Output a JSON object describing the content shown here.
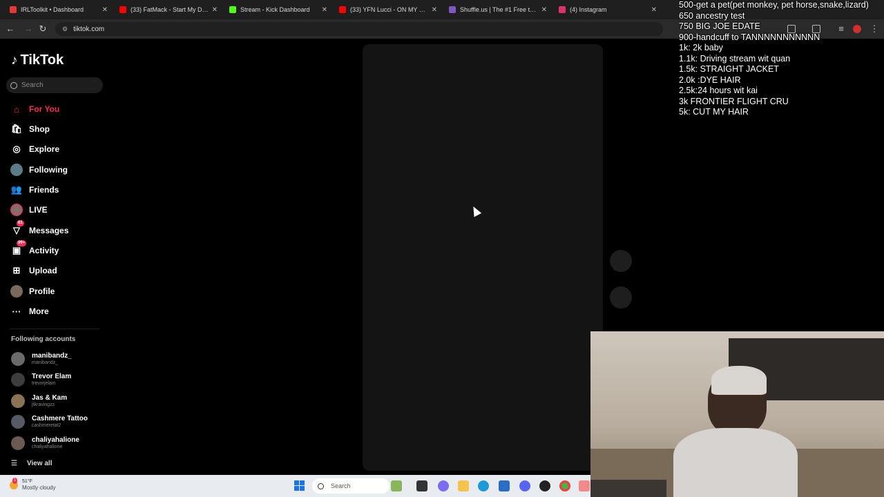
{
  "browser": {
    "tabs": [
      {
        "title": "IRLToolkit • Dashboard",
        "color": "#e53935"
      },
      {
        "title": "(33) FatMack - Start My Day [O",
        "color": "#ff0000"
      },
      {
        "title": "Stream - Kick Dashboard",
        "color": "#53fc18"
      },
      {
        "title": "(33) YFN Lucci - ON MY MIND",
        "color": "#ff0000"
      },
      {
        "title": "Shuffle.us | The #1 Free to Play",
        "color": "#7e57c2"
      },
      {
        "title": "(4) Instagram",
        "color": "#e1306c"
      }
    ],
    "address": "tiktok.com"
  },
  "tiktok": {
    "logo": "TikTok",
    "search_placeholder": "Search",
    "nav": [
      {
        "label": "For You",
        "icon": "home-icon"
      },
      {
        "label": "Shop",
        "icon": "shop-bag-icon"
      },
      {
        "label": "Explore",
        "icon": "compass-icon"
      },
      {
        "label": "Following",
        "icon": "avatar-icon"
      },
      {
        "label": "Friends",
        "icon": "friends-icon"
      },
      {
        "label": "LIVE",
        "icon": "live-avatar-icon"
      },
      {
        "label": "Messages",
        "icon": "paper-plane-icon",
        "badge": "61"
      },
      {
        "label": "Activity",
        "icon": "bell-icon",
        "badge": "99+"
      },
      {
        "label": "Upload",
        "icon": "plus-box-icon"
      },
      {
        "label": "Profile",
        "icon": "profile-avatar-icon"
      },
      {
        "label": "More",
        "icon": "ellipsis-icon"
      }
    ],
    "following_title": "Following accounts",
    "accounts": [
      {
        "name": "manibandz_",
        "handle": "manibandz_"
      },
      {
        "name": "Trevor Elam",
        "handle": "trevorjelam"
      },
      {
        "name": "Jas & Kam",
        "handle": "jtkravingzz"
      },
      {
        "name": "Cashmere Tattoo",
        "handle": "cashmeretat2"
      },
      {
        "name": "chaliyahalione",
        "handle": "chaliyahalione"
      }
    ],
    "view_all": "View all"
  },
  "overlay": {
    "goals": [
      "500-get a pet(pet monkey, pet horse,snake,lizard)",
      "650 ancestry test",
      "750 BIG JOE EDATE",
      "900-handcuff to TANNNNNNNNNNN",
      "1k: 2k baby",
      "1.1k: Driving stream wit quan",
      "1.5k: STRAIGHT JACKET",
      "2.0k :DYE HAIR",
      "2.5k:24 hours wit kai",
      "3k FRONTIER FLIGHT CRU",
      "5k: CUT MY HAIR"
    ]
  },
  "taskbar": {
    "temperature": "51°F",
    "condition": "Mostly cloudy",
    "search_placeholder": "Search",
    "weather_badge": "1"
  }
}
